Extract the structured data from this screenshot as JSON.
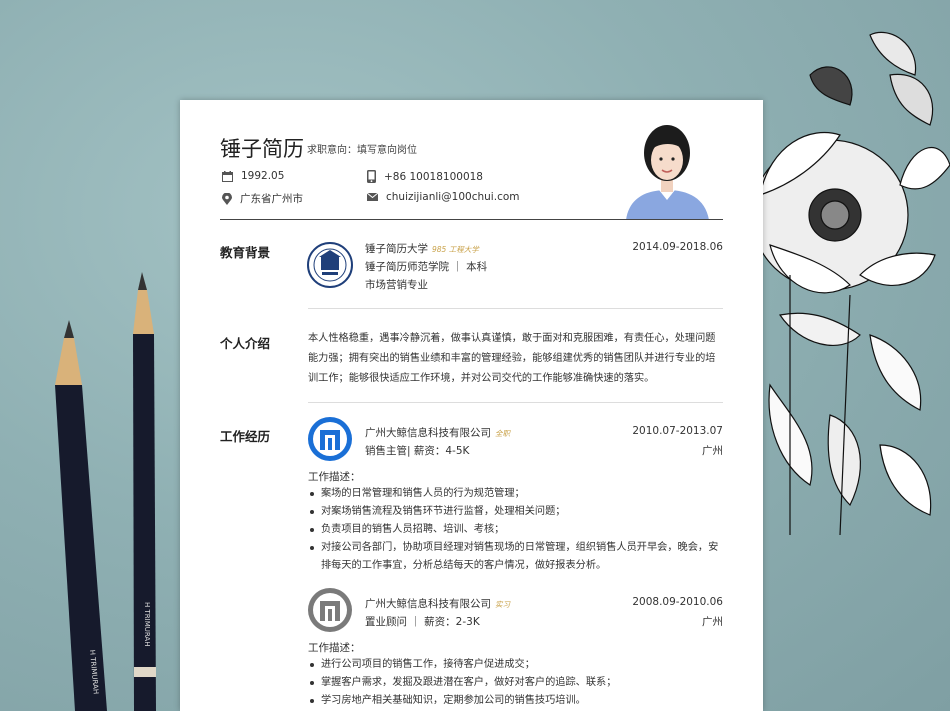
{
  "resume": {
    "name": "锤子简历",
    "intent": "求职意向：填写意向岗位",
    "birth": "1992.05",
    "phone": "+86 10018100018",
    "location": "广东省广州市",
    "email": "chuizijianli@100chui.com"
  },
  "education": {
    "title": "教育背景",
    "school": "锤子简历大学",
    "school_tag": "985 工程大学",
    "dates": "2014.09-2018.06",
    "college": "锤子简历师范学院 ｜ 本科",
    "major": "市场营销专业"
  },
  "intro": {
    "title": "个人介绍",
    "text": "本人性格稳重，遇事冷静沉着，做事认真谨慎，敢于面对和克服困难，有责任心，处理问题能力强；拥有突出的销售业绩和丰富的管理经验，能够组建优秀的销售团队并进行专业的培训工作；能够很快适应工作环境，并对公司交代的工作能够准确快速的落实。"
  },
  "work": {
    "title": "工作经历",
    "jobs": [
      {
        "company": "广州大鲸信息科技有限公司",
        "tag": "全职",
        "dates": "2010.07-2013.07",
        "role": "销售主管| 薪资：4-5K",
        "city": "广州",
        "desc_label": "工作描述：",
        "bullets": [
          "案场的日常管理和销售人员的行为规范管理；",
          "对案场销售流程及销售环节进行监督，处理相关问题；",
          "负责项目的销售人员招聘、培训、考核；",
          "对接公司各部门，协助项目经理对销售现场的日常管理，组织销售人员开早会，晚会，安排每天的工作事宜，分析总结每天的客户情况，做好报表分析。"
        ]
      },
      {
        "company": "广州大鲸信息科技有限公司",
        "tag": "实习",
        "dates": "2008.09-2010.06",
        "role": "置业顾问 ｜ 薪资：2-3K",
        "city": "广州",
        "desc_label": "工作描述：",
        "bullets": [
          "进行公司项目的销售工作，接待客户促进成交；",
          "掌握客户需求，发掘及跟进潜在客户，做好对客户的追踪、联系；",
          "学习房地产相关基础知识，定期参加公司的销售技巧培训。"
        ]
      }
    ]
  },
  "colors": {
    "accent_blue": "#1a6fd6",
    "tag_gold": "#c9a24a",
    "logo_gray": "#7a7a7a"
  }
}
